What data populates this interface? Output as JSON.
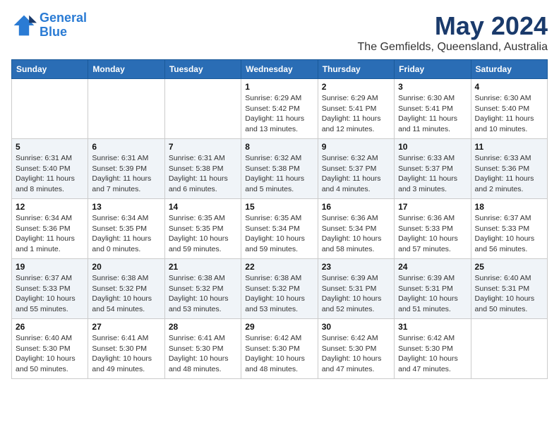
{
  "header": {
    "logo_line1": "General",
    "logo_line2": "Blue",
    "month_year": "May 2024",
    "location": "The Gemfields, Queensland, Australia"
  },
  "weekdays": [
    "Sunday",
    "Monday",
    "Tuesday",
    "Wednesday",
    "Thursday",
    "Friday",
    "Saturday"
  ],
  "weeks": [
    [
      {
        "day": "",
        "info": ""
      },
      {
        "day": "",
        "info": ""
      },
      {
        "day": "",
        "info": ""
      },
      {
        "day": "1",
        "info": "Sunrise: 6:29 AM\nSunset: 5:42 PM\nDaylight: 11 hours\nand 13 minutes."
      },
      {
        "day": "2",
        "info": "Sunrise: 6:29 AM\nSunset: 5:41 PM\nDaylight: 11 hours\nand 12 minutes."
      },
      {
        "day": "3",
        "info": "Sunrise: 6:30 AM\nSunset: 5:41 PM\nDaylight: 11 hours\nand 11 minutes."
      },
      {
        "day": "4",
        "info": "Sunrise: 6:30 AM\nSunset: 5:40 PM\nDaylight: 11 hours\nand 10 minutes."
      }
    ],
    [
      {
        "day": "5",
        "info": "Sunrise: 6:31 AM\nSunset: 5:40 PM\nDaylight: 11 hours\nand 8 minutes."
      },
      {
        "day": "6",
        "info": "Sunrise: 6:31 AM\nSunset: 5:39 PM\nDaylight: 11 hours\nand 7 minutes."
      },
      {
        "day": "7",
        "info": "Sunrise: 6:31 AM\nSunset: 5:38 PM\nDaylight: 11 hours\nand 6 minutes."
      },
      {
        "day": "8",
        "info": "Sunrise: 6:32 AM\nSunset: 5:38 PM\nDaylight: 11 hours\nand 5 minutes."
      },
      {
        "day": "9",
        "info": "Sunrise: 6:32 AM\nSunset: 5:37 PM\nDaylight: 11 hours\nand 4 minutes."
      },
      {
        "day": "10",
        "info": "Sunrise: 6:33 AM\nSunset: 5:37 PM\nDaylight: 11 hours\nand 3 minutes."
      },
      {
        "day": "11",
        "info": "Sunrise: 6:33 AM\nSunset: 5:36 PM\nDaylight: 11 hours\nand 2 minutes."
      }
    ],
    [
      {
        "day": "12",
        "info": "Sunrise: 6:34 AM\nSunset: 5:36 PM\nDaylight: 11 hours\nand 1 minute."
      },
      {
        "day": "13",
        "info": "Sunrise: 6:34 AM\nSunset: 5:35 PM\nDaylight: 11 hours\nand 0 minutes."
      },
      {
        "day": "14",
        "info": "Sunrise: 6:35 AM\nSunset: 5:35 PM\nDaylight: 10 hours\nand 59 minutes."
      },
      {
        "day": "15",
        "info": "Sunrise: 6:35 AM\nSunset: 5:34 PM\nDaylight: 10 hours\nand 59 minutes."
      },
      {
        "day": "16",
        "info": "Sunrise: 6:36 AM\nSunset: 5:34 PM\nDaylight: 10 hours\nand 58 minutes."
      },
      {
        "day": "17",
        "info": "Sunrise: 6:36 AM\nSunset: 5:33 PM\nDaylight: 10 hours\nand 57 minutes."
      },
      {
        "day": "18",
        "info": "Sunrise: 6:37 AM\nSunset: 5:33 PM\nDaylight: 10 hours\nand 56 minutes."
      }
    ],
    [
      {
        "day": "19",
        "info": "Sunrise: 6:37 AM\nSunset: 5:33 PM\nDaylight: 10 hours\nand 55 minutes."
      },
      {
        "day": "20",
        "info": "Sunrise: 6:38 AM\nSunset: 5:32 PM\nDaylight: 10 hours\nand 54 minutes."
      },
      {
        "day": "21",
        "info": "Sunrise: 6:38 AM\nSunset: 5:32 PM\nDaylight: 10 hours\nand 53 minutes."
      },
      {
        "day": "22",
        "info": "Sunrise: 6:38 AM\nSunset: 5:32 PM\nDaylight: 10 hours\nand 53 minutes."
      },
      {
        "day": "23",
        "info": "Sunrise: 6:39 AM\nSunset: 5:31 PM\nDaylight: 10 hours\nand 52 minutes."
      },
      {
        "day": "24",
        "info": "Sunrise: 6:39 AM\nSunset: 5:31 PM\nDaylight: 10 hours\nand 51 minutes."
      },
      {
        "day": "25",
        "info": "Sunrise: 6:40 AM\nSunset: 5:31 PM\nDaylight: 10 hours\nand 50 minutes."
      }
    ],
    [
      {
        "day": "26",
        "info": "Sunrise: 6:40 AM\nSunset: 5:30 PM\nDaylight: 10 hours\nand 50 minutes."
      },
      {
        "day": "27",
        "info": "Sunrise: 6:41 AM\nSunset: 5:30 PM\nDaylight: 10 hours\nand 49 minutes."
      },
      {
        "day": "28",
        "info": "Sunrise: 6:41 AM\nSunset: 5:30 PM\nDaylight: 10 hours\nand 48 minutes."
      },
      {
        "day": "29",
        "info": "Sunrise: 6:42 AM\nSunset: 5:30 PM\nDaylight: 10 hours\nand 48 minutes."
      },
      {
        "day": "30",
        "info": "Sunrise: 6:42 AM\nSunset: 5:30 PM\nDaylight: 10 hours\nand 47 minutes."
      },
      {
        "day": "31",
        "info": "Sunrise: 6:42 AM\nSunset: 5:30 PM\nDaylight: 10 hours\nand 47 minutes."
      },
      {
        "day": "",
        "info": ""
      }
    ]
  ]
}
